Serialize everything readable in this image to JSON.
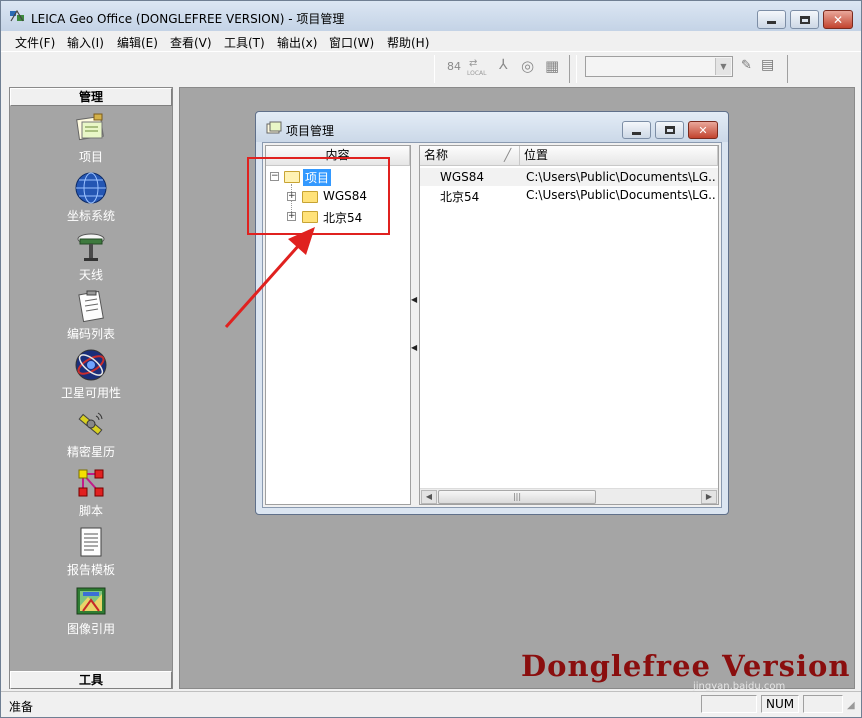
{
  "window": {
    "title": "LEICA Geo Office (DONGLEFREE VERSION) - 项目管理"
  },
  "menu": [
    "文件(F)",
    "输入(I)",
    "编辑(E)",
    "查看(V)",
    "工具(T)",
    "输出(x)",
    "窗口(W)",
    "帮助(H)"
  ],
  "toolbar": {
    "coord_label": "84",
    "local_label": "LOCAL"
  },
  "left_panel": {
    "header": "管理",
    "footer": "工具",
    "items": [
      {
        "label": "项目",
        "icon": "project-icon"
      },
      {
        "label": "坐标系统",
        "icon": "globe-icon"
      },
      {
        "label": "天线",
        "icon": "antenna-icon"
      },
      {
        "label": "编码列表",
        "icon": "clipboard-icon"
      },
      {
        "label": "卫星可用性",
        "icon": "satellite-orbit-icon"
      },
      {
        "label": "精密星历",
        "icon": "satellite-icon"
      },
      {
        "label": "脚本",
        "icon": "script-icon"
      },
      {
        "label": "报告模板",
        "icon": "report-icon"
      },
      {
        "label": "图像引用",
        "icon": "image-icon"
      }
    ]
  },
  "child_window": {
    "title": "项目管理",
    "tree_header": "内容",
    "tree": {
      "root": "项目",
      "children": [
        "WGS84",
        "北京54"
      ]
    },
    "list": {
      "columns": [
        "名称",
        "位置"
      ],
      "rows": [
        {
          "name": "WGS84",
          "location": "C:\\Users\\Public\\Documents\\LG..."
        },
        {
          "name": "北京54",
          "location": "C:\\Users\\Public\\Documents\\LG..."
        }
      ]
    }
  },
  "watermark": {
    "text": "Donglefree Version",
    "sub": "jingyan.baidu.com"
  },
  "status": {
    "text": "准备",
    "num": "NUM"
  },
  "colors": {
    "annotation": "#e0211f",
    "watermark": "#8a0e0e",
    "selection": "#3399ff"
  }
}
